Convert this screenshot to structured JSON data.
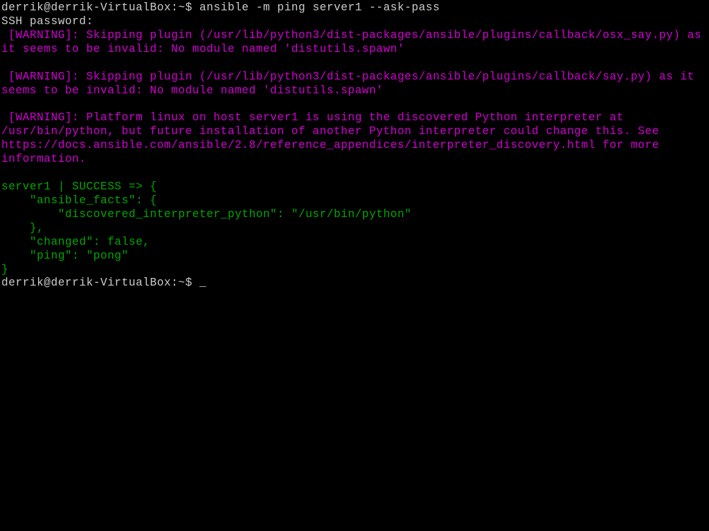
{
  "prompt1": {
    "userhost": "derrik@derrik-VirtualBox",
    "separator": ":",
    "path": "~",
    "symbol": "$ ",
    "command": "ansible -m ping server1 --ask-pass"
  },
  "ssh_prompt": "SSH password:",
  "warning1": " [WARNING]: Skipping plugin (/usr/lib/python3/dist-packages/ansible/plugins/callback/osx_say.py) as\nit seems to be invalid: No module named 'distutils.spawn'",
  "warning2": " [WARNING]: Skipping plugin (/usr/lib/python3/dist-packages/ansible/plugins/callback/say.py) as it\nseems to be invalid: No module named 'distutils.spawn'",
  "warning3": " [WARNING]: Platform linux on host server1 is using the discovered Python interpreter at\n/usr/bin/python, but future installation of another Python interpreter could change this. See\nhttps://docs.ansible.com/ansible/2.8/reference_appendices/interpreter_discovery.html for more\ninformation.",
  "success_output": "server1 | SUCCESS => {\n    \"ansible_facts\": {\n        \"discovered_interpreter_python\": \"/usr/bin/python\"\n    },\n    \"changed\": false,\n    \"ping\": \"pong\"\n}",
  "prompt2": {
    "userhost": "derrik@derrik-VirtualBox",
    "separator": ":",
    "path": "~",
    "symbol": "$ "
  },
  "cursor": "_"
}
